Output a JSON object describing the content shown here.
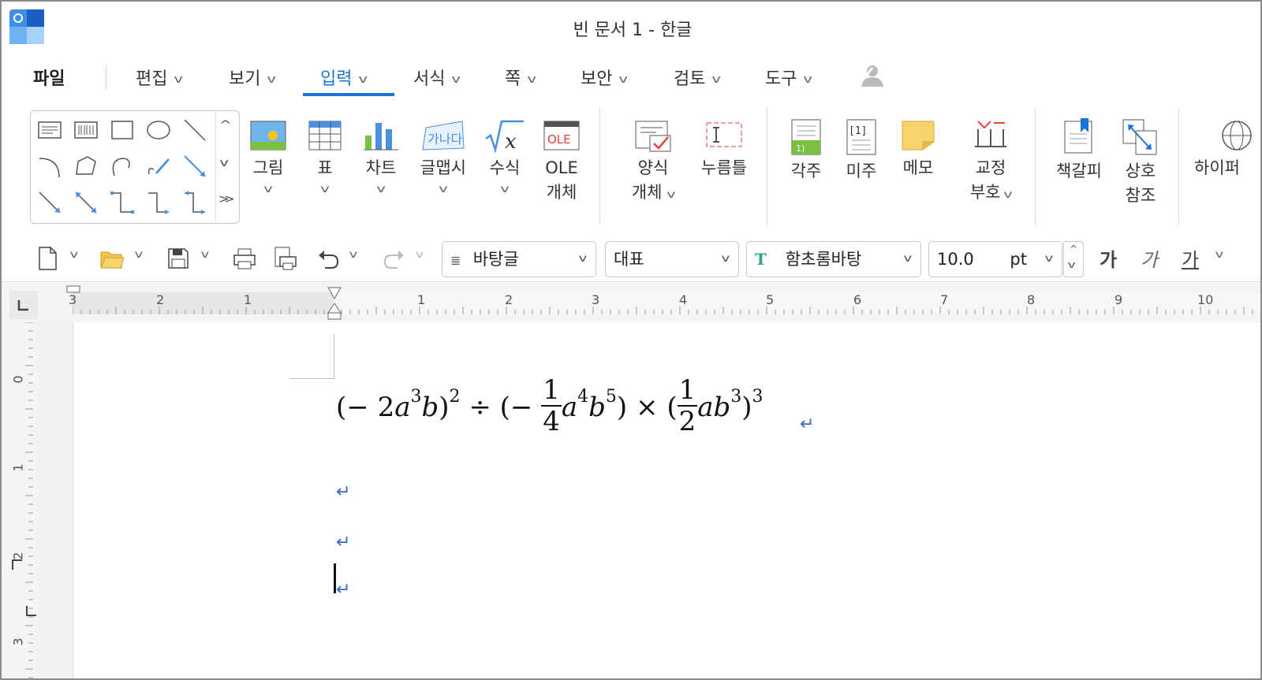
{
  "window": {
    "title": "빈 문서 1 - 한글"
  },
  "menu": {
    "file": "파일",
    "tabs": [
      {
        "label": "편집"
      },
      {
        "label": "보기"
      },
      {
        "label": "입력"
      },
      {
        "label": "서식"
      },
      {
        "label": "쪽"
      },
      {
        "label": "보안"
      },
      {
        "label": "검토"
      },
      {
        "label": "도구"
      }
    ],
    "active_tab": "입력"
  },
  "ribbon": {
    "items": [
      {
        "line1": "그림",
        "line2": ""
      },
      {
        "line1": "표",
        "line2": ""
      },
      {
        "line1": "차트",
        "line2": ""
      },
      {
        "line1": "글맵시",
        "line2": ""
      },
      {
        "line1": "수식",
        "line2": ""
      },
      {
        "line1": "OLE",
        "line2": "개체"
      },
      {
        "line1": "양식",
        "line2": "개체"
      },
      {
        "line1": "누름틀",
        "line2": ""
      },
      {
        "line1": "각주",
        "line2": ""
      },
      {
        "line1": "미주",
        "line2": ""
      },
      {
        "line1": "메모",
        "line2": ""
      },
      {
        "line1": "교정",
        "line2": "부호"
      },
      {
        "line1": "책갈피",
        "line2": ""
      },
      {
        "line1": "상호",
        "line2": "참조"
      },
      {
        "line1": "하이퍼",
        "line2": ""
      }
    ],
    "icon_text": {
      "ole": "OLE",
      "wordart": "가나다",
      "endnote": "[1]",
      "footnote": "1)"
    }
  },
  "toolbar": {
    "style": "바탕글",
    "shape_style": "대표",
    "font": "함초롬바탕",
    "font_size": "10.0",
    "unit": "pt",
    "bold": "가",
    "italic": "가",
    "underline": "가"
  },
  "ruler": {
    "horizontal": [
      "3",
      "2",
      "1",
      "1",
      "2",
      "3",
      "4",
      "5",
      "6",
      "7",
      "8",
      "9",
      "10"
    ],
    "vertical": [
      "0",
      "1",
      "2",
      "3"
    ]
  },
  "document": {
    "equation": {
      "p1_open": "(−",
      "p1_coef": "2",
      "p1_a": "a",
      "p1_a_exp": "3",
      "p1_b": "b",
      "p1_close": ")",
      "p1_exp": "2",
      "div": "÷",
      "p2_open": "(−",
      "p2_num": "1",
      "p2_den": "4",
      "p2_a": "a",
      "p2_a_exp": "4",
      "p2_b": "b",
      "p2_b_exp": "5",
      "p2_close": ")",
      "times": "×",
      "p3_open": "(",
      "p3_num": "1",
      "p3_den": "2",
      "p3_ab": "ab",
      "p3_b_exp": "3",
      "p3_close": ")",
      "p3_exp": "3"
    },
    "paragraph_mark": "↵"
  },
  "colors": {
    "accent": "#1a73d6",
    "para_mark": "#3a63c8"
  }
}
